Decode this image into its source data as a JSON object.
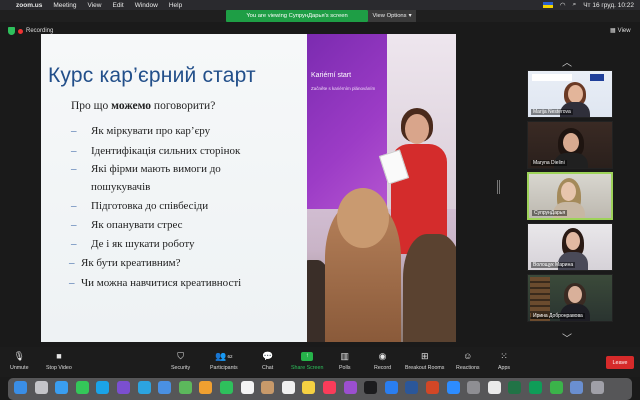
{
  "menubar": {
    "app": "zoom.us",
    "items": [
      "Meeting",
      "View",
      "Edit",
      "Window",
      "Help"
    ],
    "datetime": "Чт 16 груд.  10:22"
  },
  "banner": {
    "viewing_text": "You are viewing СупрунДарья's screen",
    "view_options": "View Options"
  },
  "status": {
    "recording": "Recording",
    "view_label": "View"
  },
  "slide": {
    "title": "Курс кар’єрний старт",
    "subtitle_pre": "Про що ",
    "subtitle_bold": "можемо",
    "subtitle_post": " поговорити?",
    "bullets": [
      "Як міркувати про кар’єру",
      "Ідентифікація сильних сторінок",
      "Які фірми мають вимоги до",
      "пошукувачів",
      "Підготовка до співбесіди",
      "Як опанувати стрес",
      "Де і як шукати роботу",
      "Як бути креативним?",
      "Чи можна навчитися креативності"
    ],
    "screen_title": "Kariérní start",
    "screen_sub": "Začněte s kariérním plánováním"
  },
  "participants": [
    {
      "name": "Marija Nesterova"
    },
    {
      "name": "Maryna Dielini"
    },
    {
      "name": "СупрунДарья"
    },
    {
      "name": "Волощук Марина"
    },
    {
      "name": "Ирина Добронравова"
    }
  ],
  "toolbar": {
    "unmute": "Unmute",
    "stop_video": "Stop Video",
    "security": "Security",
    "participants": "Participants",
    "participants_count": "62",
    "chat": "Chat",
    "share_screen": "Share Screen",
    "polls": "Polls",
    "record": "Record",
    "breakout": "Breakout Rooms",
    "reactions": "Reactions",
    "apps": "Apps",
    "leave": "Leave"
  },
  "colors": {
    "title_blue": "#224f8a",
    "share_green": "#26b34a",
    "leave_red": "#d62a2a",
    "active_tile": "#9ed35a"
  },
  "dock_apps": [
    "finder-icon",
    "launchpad-icon",
    "safari-icon",
    "messages-icon",
    "skype-icon",
    "viber-icon",
    "telegram-icon",
    "mail-icon",
    "maps-icon",
    "photos-icon",
    "facetime-icon",
    "calendar-icon",
    "contacts-icon",
    "reminders-icon",
    "notes-icon",
    "music-icon",
    "podcasts-icon",
    "tv-icon",
    "appstore-icon",
    "word-icon",
    "powerpoint-icon",
    "zoom-icon",
    "preferences-icon",
    "chrome-icon",
    "excel-icon",
    "sheets-icon",
    "numbers-icon",
    "downloads-icon",
    "trash-icon"
  ]
}
